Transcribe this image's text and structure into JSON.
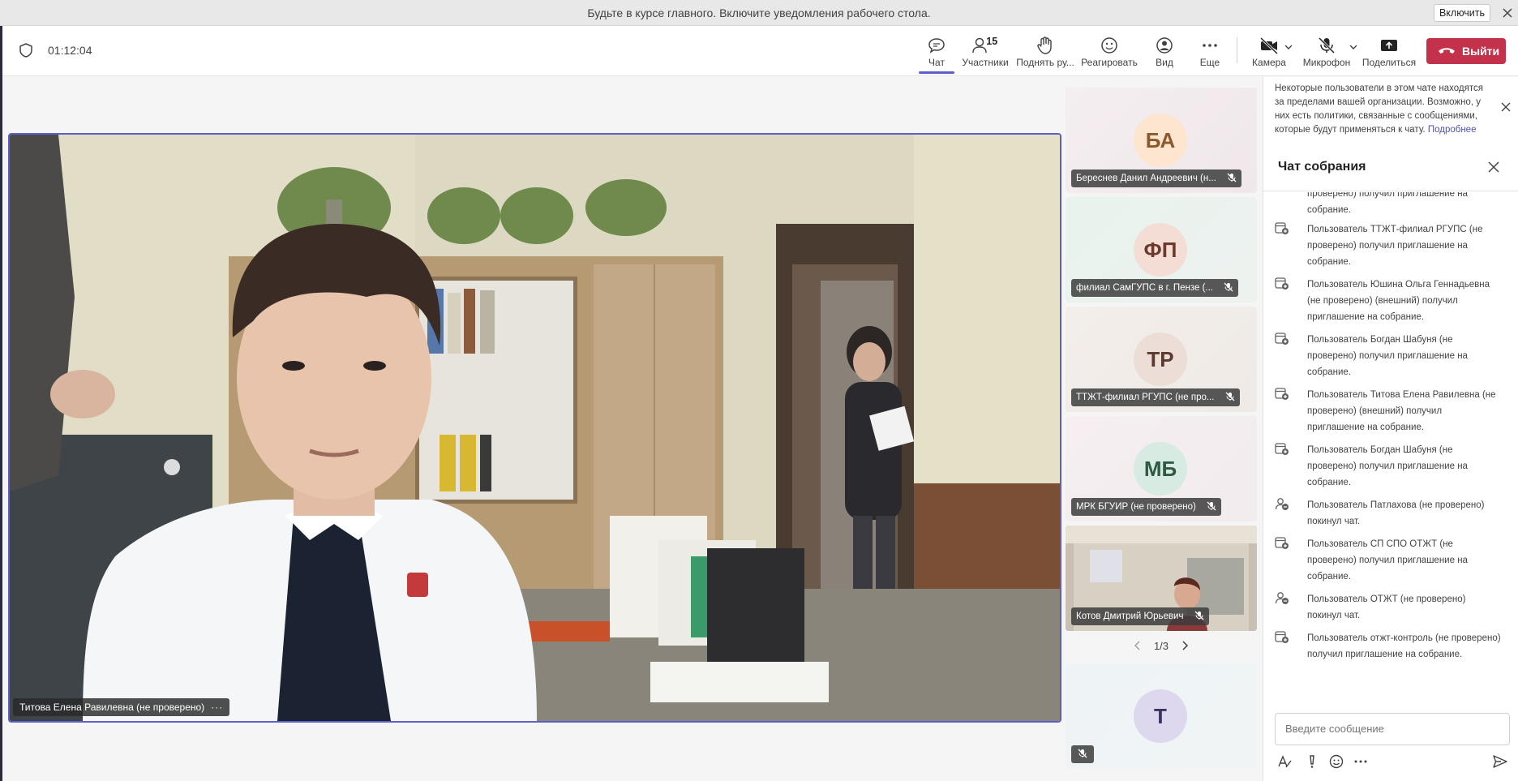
{
  "notification": {
    "text": "Будьте в курсе главного. Включите уведомления рабочего стола.",
    "enable_label": "Включить"
  },
  "meeting": {
    "timer": "01:12:04"
  },
  "toolbar": {
    "chat": "Чат",
    "participants": "Участники",
    "participants_count": "15",
    "raise_hand": "Поднять ру...",
    "react": "Реагировать",
    "view": "Вид",
    "more": "Еще",
    "camera": "Камера",
    "mic": "Микрофон",
    "share": "Поделиться",
    "leave": "Выйти"
  },
  "stage": {
    "speaker_name": "Титова Елена Равилевна (не проверено)",
    "more_dots": "···"
  },
  "gallery": {
    "tiles": [
      {
        "initials": "БА",
        "name": "Береснев Данил Андреевич (н..."
      },
      {
        "initials": "ФП",
        "name": "филиал СамГУПС в г. Пензе (..."
      },
      {
        "initials": "ТР",
        "name": "ТТЖТ-филиал РГУПС (не про..."
      },
      {
        "initials": "МБ",
        "name": "МРК БГУИР (не проверено)"
      },
      {
        "initials": "",
        "name": "Котов Дмитрий Юрьевич"
      }
    ],
    "pager": "1/3",
    "next_tile_initial": "T"
  },
  "chat_panel": {
    "org_note": "Некоторые пользователи в этом чате находятся за пределами вашей организации. Возможно, у них есть политики, связанные с сообщениями, которые будут применяться к чату.",
    "org_note_link": "Подробнее",
    "title": "Чат собрания",
    "messages": [
      "проверено) получил приглашение на собрание.",
      "Пользователь ТТЖТ-филиал РГУПС (не проверено) получил приглашение на собрание.",
      "Пользователь Юшина Ольга Геннадьевна (не проверено) (внешний) получил приглашение на собрание.",
      "Пользователь Богдан Шабуня (не проверено) получил приглашение на собрание.",
      "Пользователь Титова Елена Равилевна (не проверено) (внешний) получил приглашение на собрание.",
      "Пользователь Богдан Шабуня (не проверено) получил приглашение на собрание.",
      "Пользователь Патлахова (не проверено) покинул чат.",
      "Пользователь СП СПО ОТЖТ (не проверено) получил приглашение на собрание.",
      "Пользователь ОТЖТ (не проверено) покинул чат.",
      "Пользователь отжт-контроль (не проверено) получил приглашение на собрание."
    ],
    "compose_placeholder": "Введите сообщение"
  }
}
